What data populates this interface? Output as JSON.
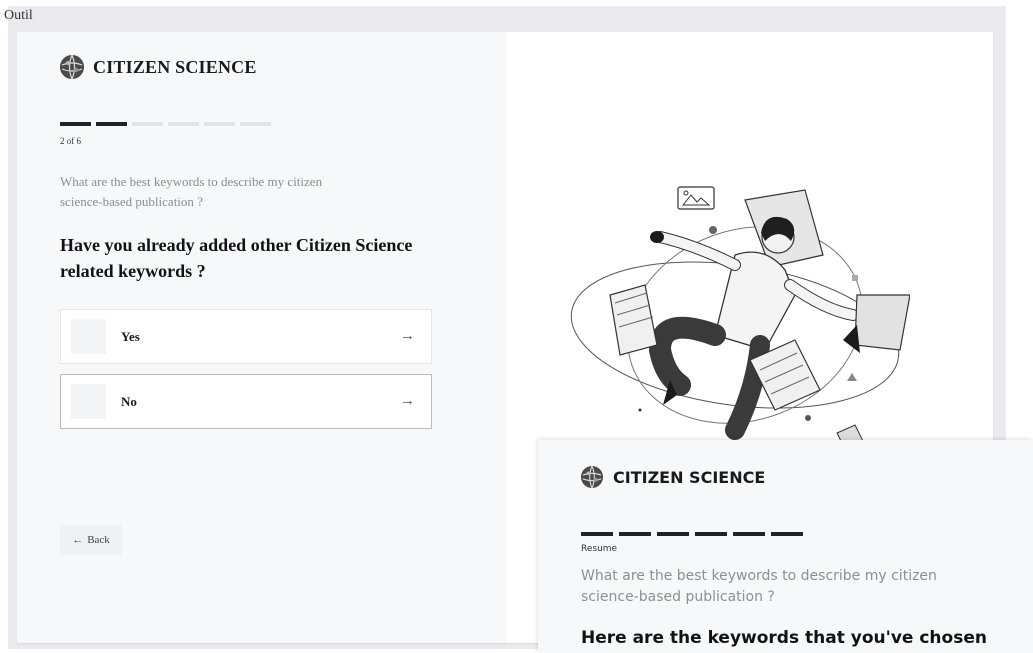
{
  "window": {
    "title": "Outil"
  },
  "brand": {
    "name": "CITIZEN SCIENCE"
  },
  "progress": {
    "current": 2,
    "total": 6,
    "label": "2 of 6"
  },
  "question": {
    "context": "What are the best keywords to describe my citizen science-based publication ?",
    "title": "Have you already added other Citizen Science related keywords ?"
  },
  "options": [
    {
      "label": "Yes",
      "arrow": "→"
    },
    {
      "label": "No",
      "arrow": "→"
    }
  ],
  "back": {
    "icon": "←",
    "label": "Back"
  },
  "overlay": {
    "brand_name": "CITIZEN SCIENCE",
    "progress": {
      "completed": 6,
      "total": 6
    },
    "step_label": "Resume",
    "context": "What are the best keywords to describe my citizen science-based publication ?",
    "title": "Here are the keywords that you've chosen"
  },
  "colors": {
    "accent": "#1f2226",
    "panel_bg": "#f7f8f9",
    "frame_bg": "#ebeaef",
    "muted_text": "#8a8d91"
  },
  "icons": {
    "brand": "globe-logo-icon",
    "option_arrow": "arrow-right-icon",
    "back": "arrow-left-icon"
  }
}
